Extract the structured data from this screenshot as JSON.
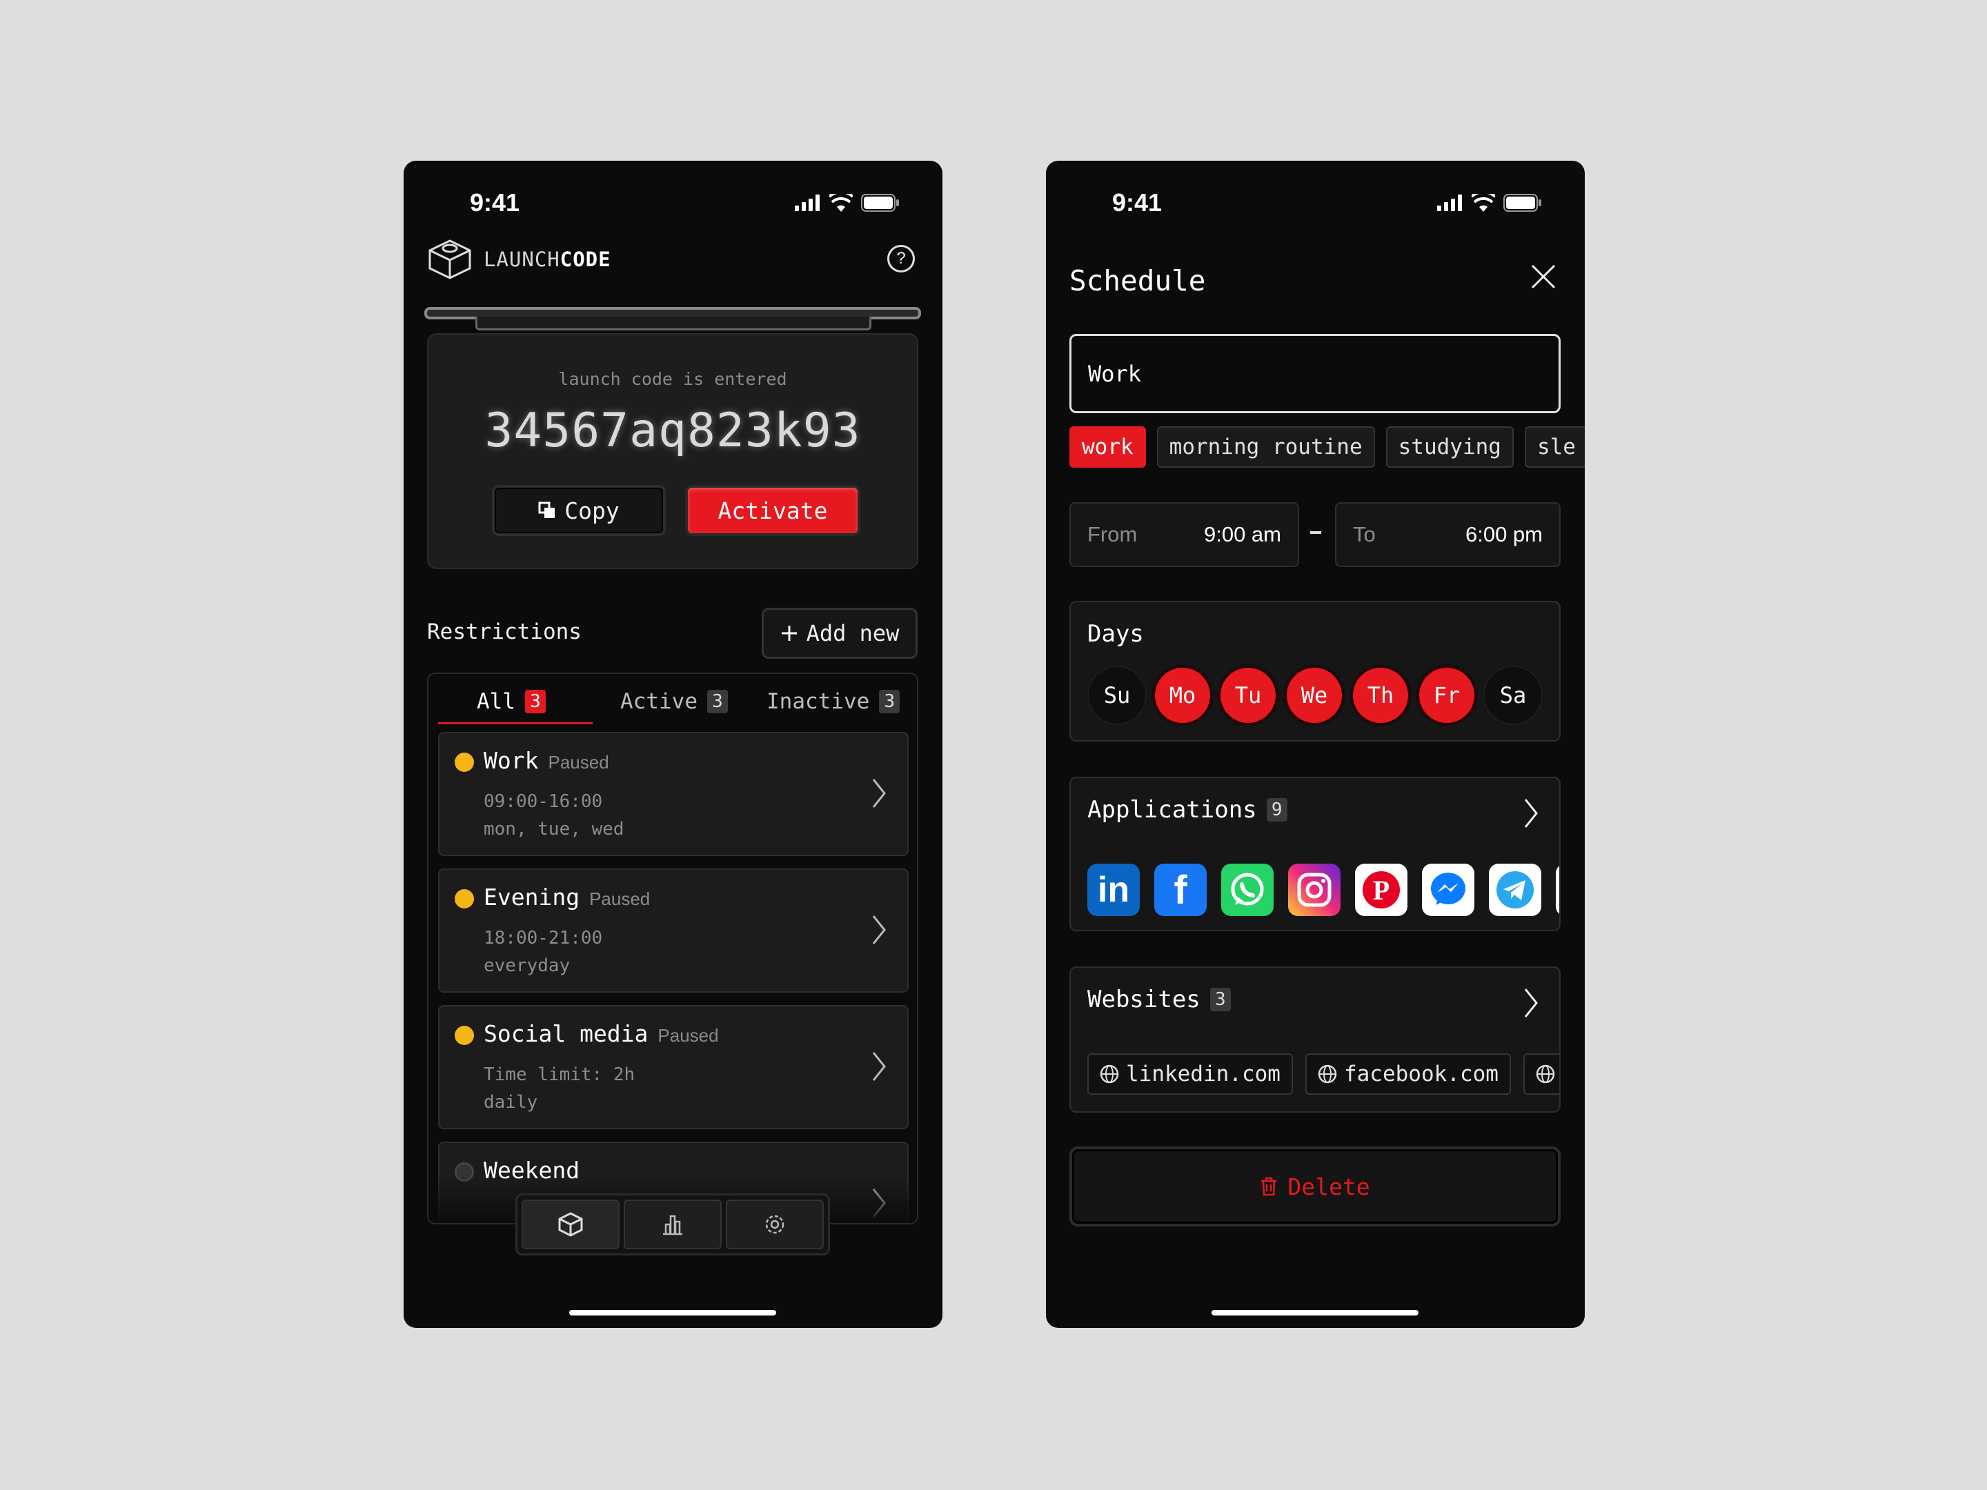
{
  "left": {
    "status_time": "9:41",
    "brand": {
      "light": "LAUNCH",
      "bold": "CODE"
    },
    "code": {
      "caption": "launch code is entered",
      "value": "34567aq823k93",
      "copy_label": "Copy",
      "activate_label": "Activate"
    },
    "restrictions": {
      "title": "Restrictions",
      "add_label": "Add new",
      "tabs": [
        {
          "label": "All",
          "count": "3"
        },
        {
          "label": "Active",
          "count": "3"
        },
        {
          "label": "Inactive",
          "count": "3"
        }
      ],
      "items": [
        {
          "name": "Work",
          "status": "Paused",
          "line1": "09:00-16:00",
          "line2": "mon, tue, wed"
        },
        {
          "name": "Evening",
          "status": "Paused",
          "line1": "18:00-21:00",
          "line2": "everyday"
        },
        {
          "name": "Social media",
          "status": "Paused",
          "line1": "Time limit: 2h",
          "line2": "daily"
        },
        {
          "name": "Weekend",
          "status": "",
          "line1": "",
          "line2": ""
        }
      ]
    },
    "tabbar": [
      "launch-icon",
      "stats-icon",
      "settings-icon"
    ]
  },
  "right": {
    "status_time": "9:41",
    "title": "Schedule",
    "name_value": "Work",
    "tags": [
      "work",
      "morning routine",
      "studying",
      "sle"
    ],
    "from_label": "From",
    "from_value": "9:00 am",
    "to_label": "To",
    "to_value": "6:00 pm",
    "days_title": "Days",
    "days": [
      {
        "label": "Su",
        "on": false
      },
      {
        "label": "Mo",
        "on": true
      },
      {
        "label": "Tu",
        "on": true
      },
      {
        "label": "We",
        "on": true
      },
      {
        "label": "Th",
        "on": true
      },
      {
        "label": "Fr",
        "on": true
      },
      {
        "label": "Sa",
        "on": false
      }
    ],
    "applications_title": "Applications",
    "applications_count": "9",
    "applications": [
      {
        "name": "linkedin-icon",
        "color": "#0a66c2"
      },
      {
        "name": "facebook-icon",
        "color": "#1877f2"
      },
      {
        "name": "whatsapp-icon",
        "color": "#25d366"
      },
      {
        "name": "instagram-icon",
        "color": "#d6249f"
      },
      {
        "name": "pinterest-icon",
        "color": "#ffffff"
      },
      {
        "name": "messenger-icon",
        "color": "#ffffff"
      },
      {
        "name": "telegram-icon",
        "color": "#ffffff"
      }
    ],
    "websites_title": "Websites",
    "websites_count": "3",
    "websites": [
      "linkedin.com",
      "facebook.com"
    ],
    "delete_label": "Delete"
  },
  "colors": {
    "accent": "#e5191f",
    "paused": "#f5b517",
    "background": "#0b0b0b"
  }
}
